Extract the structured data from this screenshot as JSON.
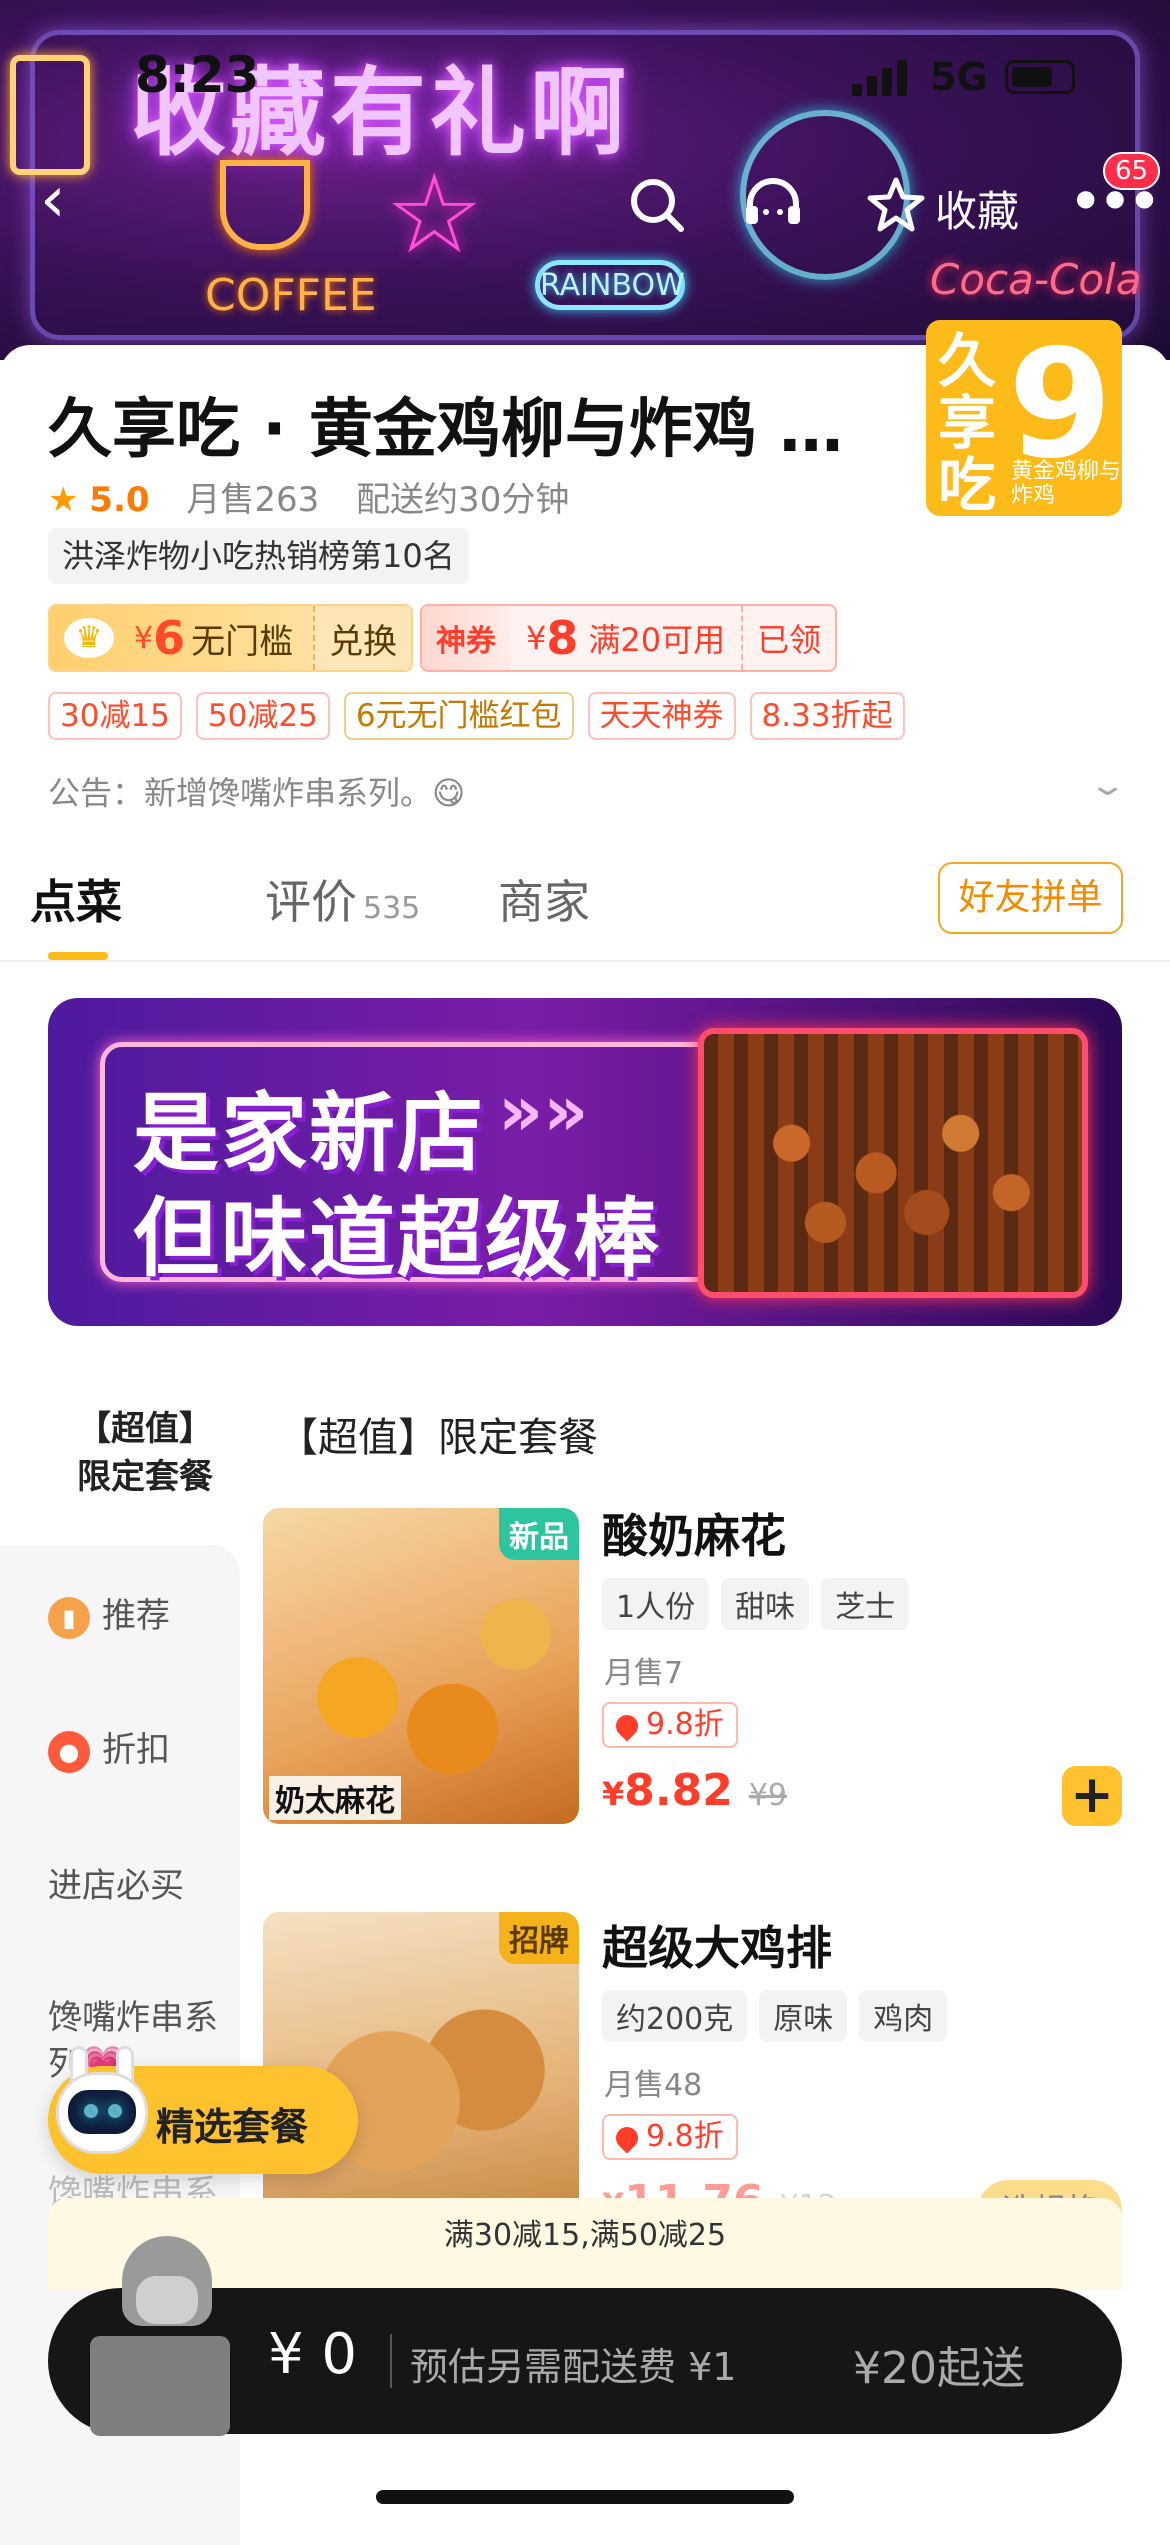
{
  "status": {
    "time": "8:23",
    "network": "5G"
  },
  "hero": {
    "title": "收藏有礼啊",
    "coffee": "COFFEE",
    "rainbow": "RAINBOW",
    "cola": "Coca-Cola"
  },
  "nav": {
    "favorite_label": "收藏",
    "badge": "65"
  },
  "store": {
    "name": "久享吃 · 黄金鸡柳与炸鸡 …",
    "logo_text": "久享吃",
    "logo_number": "9",
    "logo_sub": "黄金鸡柳与炸鸡",
    "rating": "5.0",
    "monthly_sales": "月售263",
    "delivery_time": "配送约30分钟",
    "rank": "洪泽炸物小吃热销榜第10名",
    "notice": "公告：新增馋嘴炸串系列。😋"
  },
  "coupons": {
    "vip": {
      "yen": "¥",
      "amount": "6",
      "desc": "无门槛",
      "action": "兑换"
    },
    "god": {
      "tag": "神券",
      "yen": "¥",
      "amount": "8",
      "desc": "满20可用",
      "status": "已领"
    }
  },
  "promos": [
    "30减15",
    "50减25",
    "6元无门槛红包",
    "天天神券",
    "8.33折起"
  ],
  "tabs": [
    {
      "label": "点菜"
    },
    {
      "label": "评价",
      "count": "535"
    },
    {
      "label": "商家"
    }
  ],
  "friend_order": "好友拼单",
  "banner": {
    "line1": "是家新店",
    "line2": "但味道超级棒"
  },
  "sidebar": {
    "current": "【超值】\n限定套餐",
    "items": [
      "推荐",
      "折扣",
      "进店必买",
      "馋嘴炸串系列💗",
      "馋嘴炸串系列"
    ]
  },
  "section_title": "【超值】限定套餐",
  "dishes": [
    {
      "tag": "新品",
      "name": "酸奶麻花",
      "chips": [
        "1人份",
        "甜味",
        "芝士"
      ],
      "sold": "月售7",
      "discount": "9.8折",
      "price_yen": "¥",
      "price": "8.82",
      "original": "¥9",
      "img_caption": "奶太麻花",
      "tag_color": "#2fc4a0"
    },
    {
      "tag": "招牌",
      "name": "超级大鸡排",
      "chips": [
        "约200克",
        "原味",
        "鸡肉"
      ],
      "sold": "月售48",
      "discount": "9.8折",
      "price_yen": "¥",
      "price": "11.76",
      "original": "¥12",
      "tag_color": "#f6b21b"
    }
  ],
  "spec_button": "选规格",
  "floating": {
    "label": "精选套餐"
  },
  "promo_bar": "满30减15,满50减25",
  "cart": {
    "amount": "¥ 0",
    "fee": "预估另需配送费 ¥1",
    "min": "¥20起送"
  }
}
